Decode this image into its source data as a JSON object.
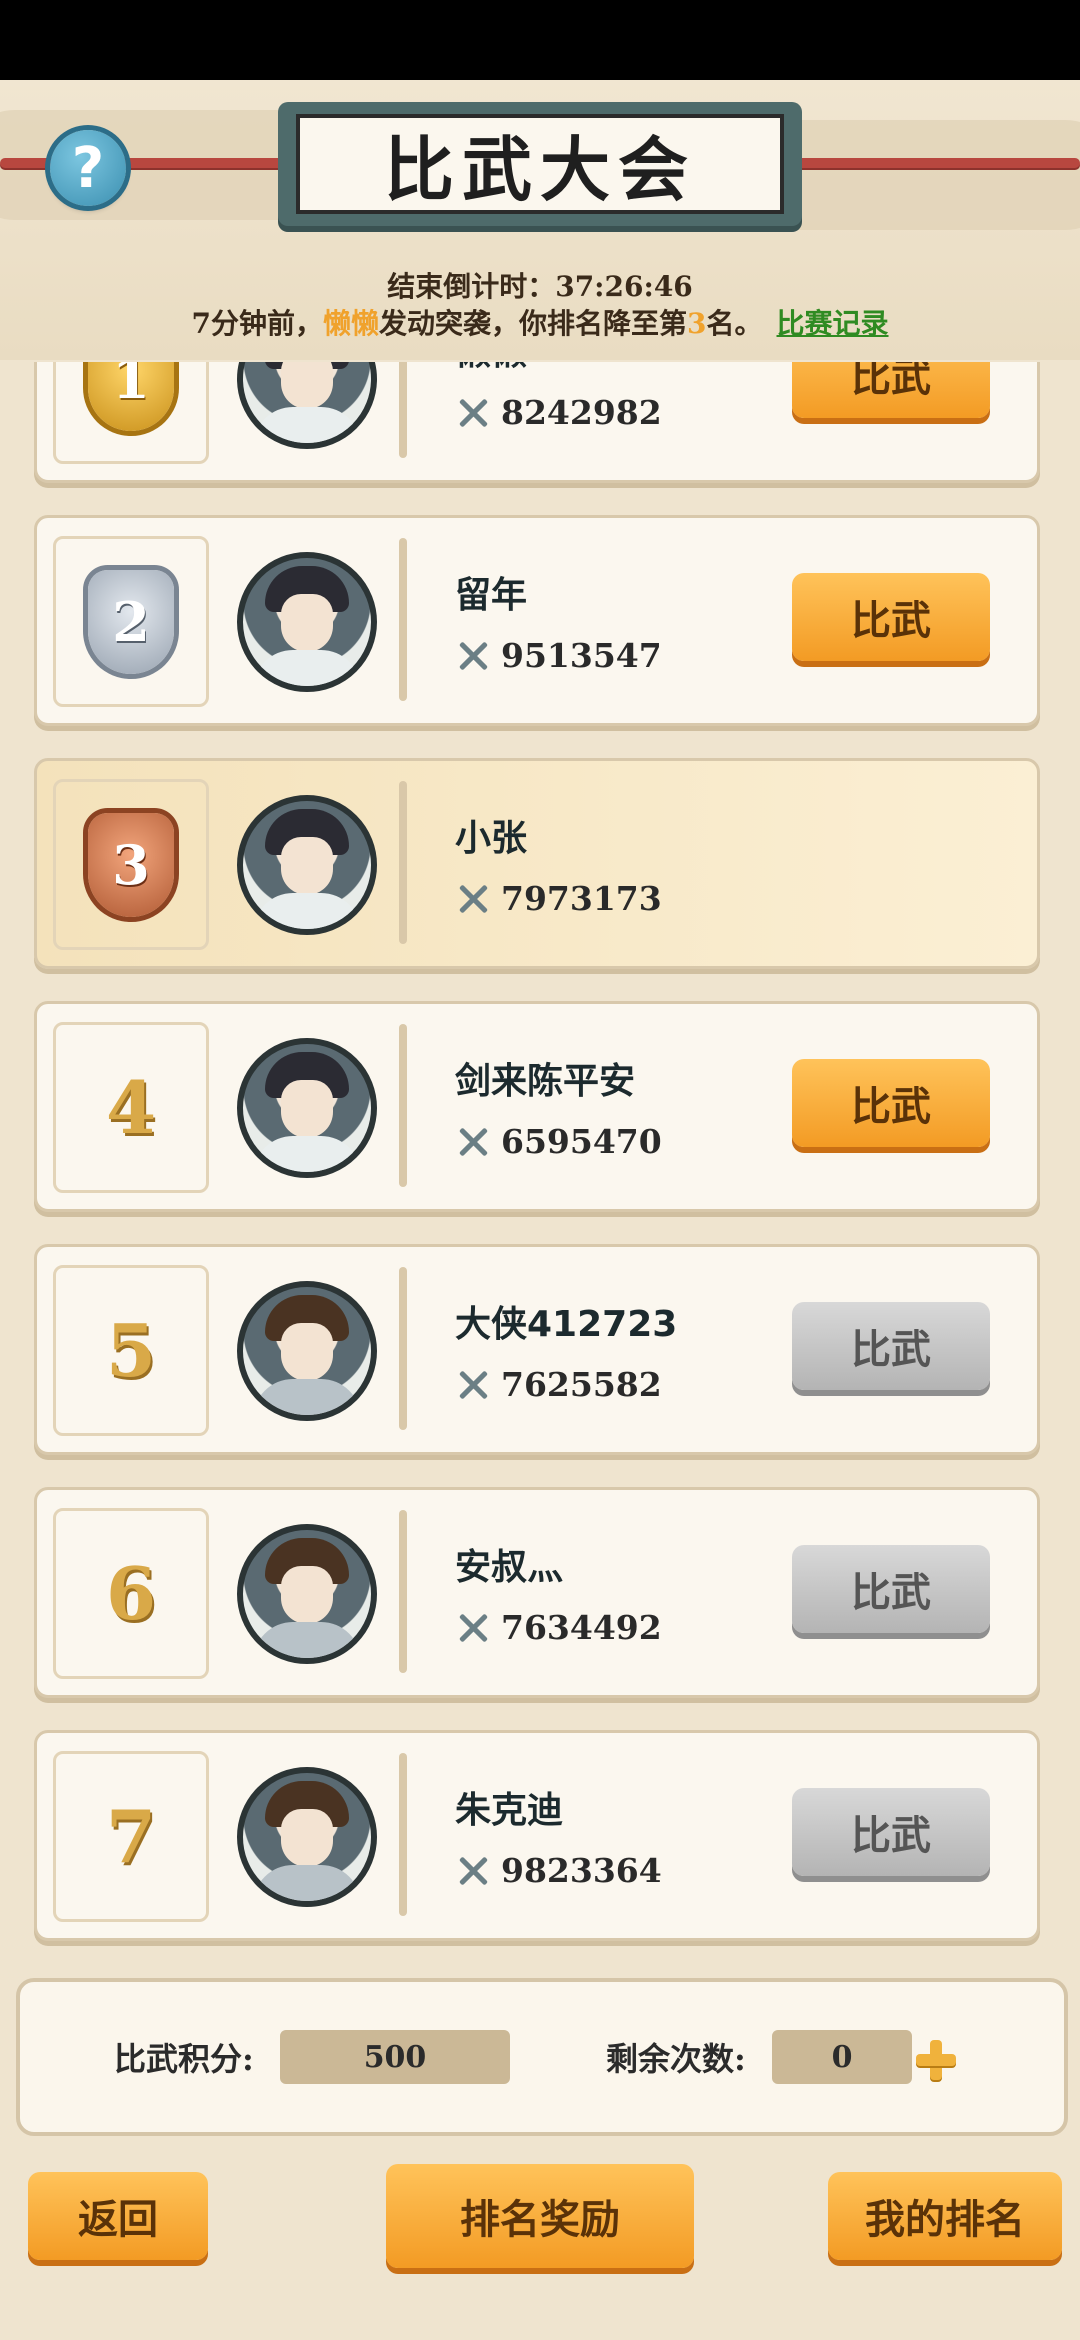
{
  "header": {
    "title": "比武大会",
    "countdown_label": "结束倒计时：",
    "countdown_value": "37:26:46",
    "notice_prefix": "7分钟前，",
    "notice_attacker": "懒懒",
    "notice_mid": "发动突袭，你排名降至第",
    "notice_rank": "3",
    "notice_suffix": "名。",
    "record_link": "比赛记录",
    "help_label": "?"
  },
  "rows": [
    {
      "rank": "1",
      "name": "懒懒",
      "power": "8242982",
      "button": "比武",
      "button_state": "active"
    },
    {
      "rank": "2",
      "name": "留年",
      "power": "9513547",
      "button": "比武",
      "button_state": "active"
    },
    {
      "rank": "3",
      "name": "小张",
      "power": "7973173",
      "button": "",
      "button_state": "self"
    },
    {
      "rank": "4",
      "name": "剑来陈平安",
      "power": "6595470",
      "button": "比武",
      "button_state": "active"
    },
    {
      "rank": "5",
      "name": "大侠412723",
      "power": "7625582",
      "button": "比武",
      "button_state": "disabled"
    },
    {
      "rank": "6",
      "name": "安叔灬",
      "power": "7634492",
      "button": "比武",
      "button_state": "disabled"
    },
    {
      "rank": "7",
      "name": "朱克迪",
      "power": "9823364",
      "button": "比武",
      "button_state": "disabled"
    }
  ],
  "score": {
    "points_label": "比武积分:",
    "points_value": "500",
    "remaining_label": "剩余次数:",
    "remaining_value": "0"
  },
  "footer": {
    "back": "返回",
    "ranking_reward": "排名奖励",
    "my_rank": "我的排名"
  },
  "colors": {
    "accent_orange": "#f39b24",
    "highlight_name": "#f0a22c",
    "record_link": "#2f8b22",
    "disabled_gray": "#b4b4b4"
  }
}
